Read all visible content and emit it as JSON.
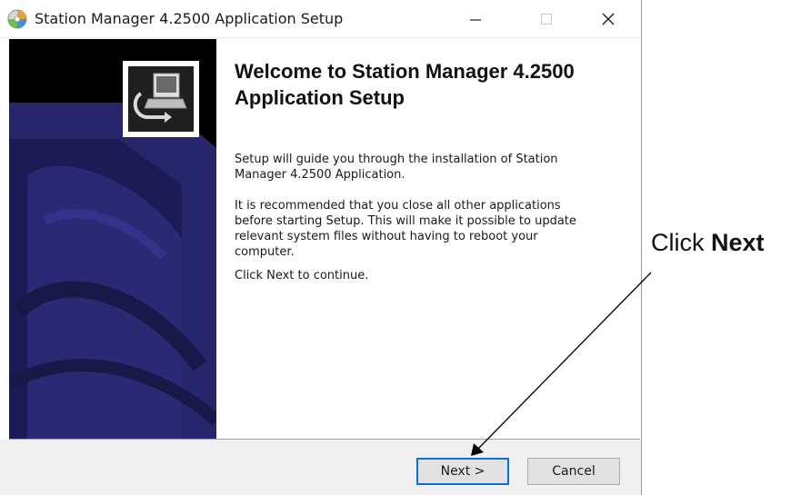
{
  "window": {
    "title": "Station Manager 4.2500 Application Setup",
    "controls": {
      "minimize": "—",
      "maximize": "☐",
      "close": "✕"
    }
  },
  "icons": {
    "app": "setup-cd-icon",
    "logo": "computer-monitor-icon"
  },
  "content": {
    "heading": "Welcome to Station Manager 4.2500 Application Setup",
    "paragraph1": "Setup will guide you through the installation of Station Manager 4.2500 Application.",
    "paragraph2": "It is recommended that you close all other applications before starting Setup. This will make it possible to update relevant system files without having to reboot your computer.",
    "paragraph3": "Click Next to continue."
  },
  "buttons": {
    "next": "Next >",
    "cancel": "Cancel"
  },
  "annotation": {
    "prefix": "Click ",
    "emphasis": "Next"
  },
  "colors": {
    "sidebar_bg": "#000000",
    "sidebar_art": "#27256b",
    "focus_border": "#0a6fd6"
  }
}
